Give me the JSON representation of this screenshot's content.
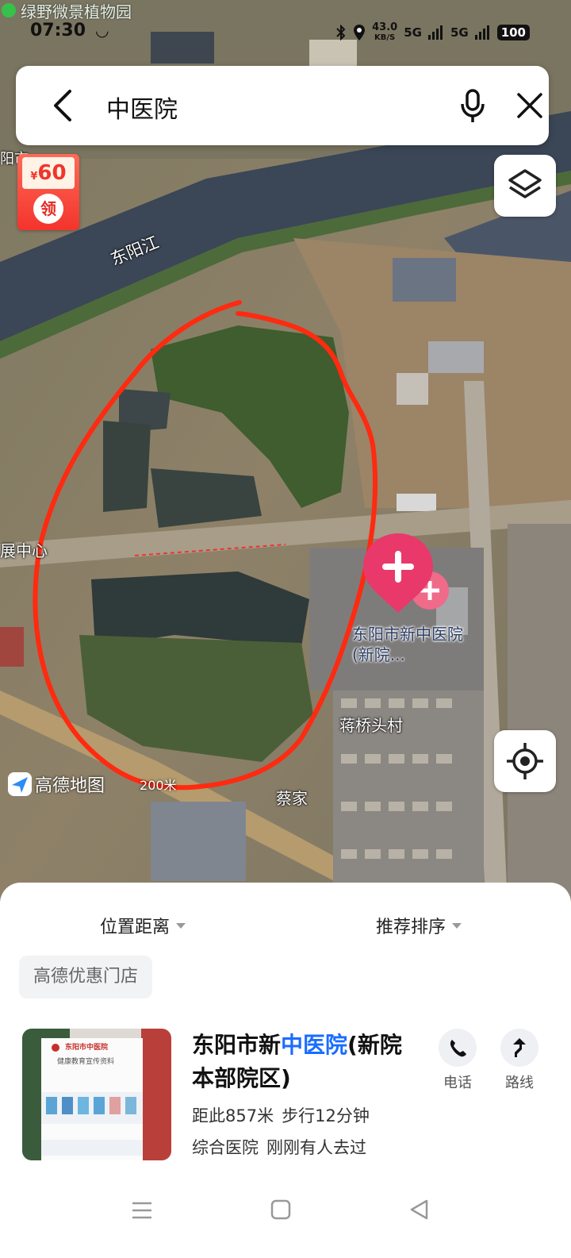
{
  "status": {
    "notification": "绿野微景植物园",
    "time": "07:30",
    "net_speed": "43.0",
    "net_unit": "KB/S",
    "sim1": "5G",
    "sim2": "5G",
    "battery": "100"
  },
  "search": {
    "query": "中医院"
  },
  "map": {
    "coupon_currency": "¥",
    "coupon_amount": "60",
    "coupon_action": "领",
    "labels": {
      "river": "东阳江",
      "district_partial": "展中心",
      "village_1": "蒋桥头村",
      "village_2": "蔡家",
      "city_partial_1": "阳市",
      "city_partial_2": "家"
    },
    "poi_name": "东阳市新中医院(新院...",
    "brand": "高德地图",
    "scale": "200米"
  },
  "filters": {
    "distance": "位置距离",
    "sort": "推荐排序"
  },
  "promo_chip": "高德优惠门店",
  "result": {
    "title_prefix": "东阳市新",
    "title_highlight": "中医院",
    "title_suffix": "(新院本部院区)",
    "distance": "距此857米",
    "walk": "步行12分钟",
    "category": "综合医院",
    "activity": "刚刚有人去过",
    "call_label": "电话",
    "route_label": "路线",
    "thumb_caption": "东阳市中医院",
    "thumb_subcaption": "健康教育宣传资料"
  },
  "colors": {
    "accent": "#1a6dff",
    "coupon": "#f3342c",
    "poi_pin": "#e8396a",
    "annotation": "#ff2a10"
  }
}
